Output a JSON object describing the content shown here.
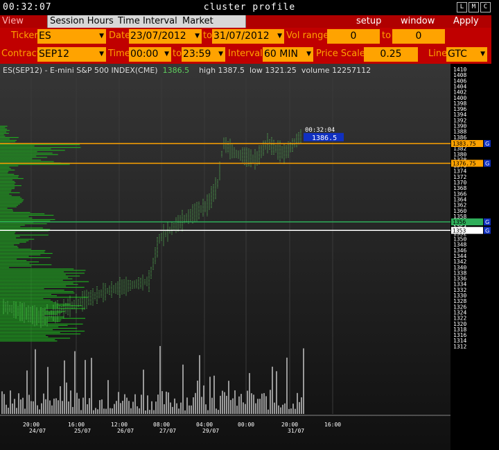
{
  "titlebar": {
    "clock": "00:32:07",
    "title": "cluster profile",
    "buttons": [
      "L",
      "M",
      "C"
    ]
  },
  "menubar": {
    "tabs": [
      "View DOM",
      "Session Hours",
      "Time Interval",
      "Market Watch"
    ],
    "actions": [
      "setup",
      "window",
      "Apply"
    ]
  },
  "params": {
    "ticker_label": "Ticker",
    "ticker": "ES",
    "date_label": "Date",
    "date_from": "23/07/2012",
    "to_label": "to",
    "date_to": "31/07/2012",
    "volrange_label": "Vol range",
    "vol_from": "0",
    "vol_to_label": "to",
    "vol_to": "0",
    "contract_label": "Contract",
    "contract": "SEP12",
    "time_label": "Time",
    "time_from": "00:00",
    "time_to_label": "to",
    "time_to": "23:59",
    "interval_label": "Interval",
    "interval": "60 MIN",
    "pricescale_label": "Price Scale",
    "pricescale": "0.25",
    "line_label": "Line",
    "line": "GTC"
  },
  "info": {
    "symbol": "ES(SEP12) - E-mini S&P 500 INDEX(CME)",
    "last": "1386.5",
    "high": "high 1387.5",
    "low": "low 1321.25",
    "volume": "volume 12257112"
  },
  "price_axis": [
    "1410",
    "1408",
    "1406",
    "1404",
    "1402",
    "1400",
    "1398",
    "1396",
    "1394",
    "1392",
    "1390",
    "1388",
    "1386",
    "1384",
    "1382",
    "1380",
    "1378",
    "1376",
    "1374",
    "1372",
    "1370",
    "1368",
    "1366",
    "1364",
    "1362",
    "1360",
    "1358",
    "1356",
    "1354",
    "1352",
    "1350",
    "1348",
    "1346",
    "1344",
    "1342",
    "1340",
    "1338",
    "1336",
    "1334",
    "1332",
    "1330",
    "1328",
    "1326",
    "1324",
    "1322",
    "1320",
    "1318",
    "1316",
    "1314",
    "1312"
  ],
  "lines": [
    {
      "label": "1383.75",
      "color": "#ffa300",
      "tag": "G"
    },
    {
      "label": "1376.75",
      "color": "#ffa300",
      "tag": "G"
    },
    {
      "label": "1356",
      "color": "#2fae5a",
      "tag": "G"
    },
    {
      "label": "1353",
      "color": "#ffffff",
      "tag": "G"
    }
  ],
  "time_labels": [
    {
      "time": "20:00",
      "date": "24/07"
    },
    {
      "time": "16:00",
      "date": "25/07"
    },
    {
      "time": "12:00",
      "date": "26/07"
    },
    {
      "time": "08:00",
      "date": "27/07"
    },
    {
      "time": "04:00",
      "date": "29/07"
    },
    {
      "time": "00:00",
      "date": ""
    },
    {
      "time": "20:00",
      "date": "31/07"
    },
    {
      "time": "16:00",
      "date": ""
    }
  ],
  "current_price": {
    "time": "00:32:04",
    "price": "1386.5"
  }
}
